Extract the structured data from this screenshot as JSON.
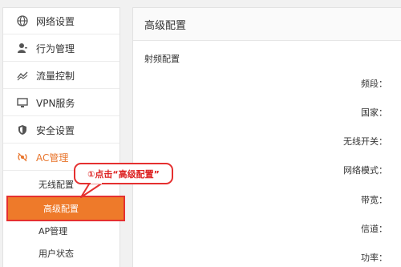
{
  "sidebar": {
    "items": [
      {
        "label": "网络设置",
        "icon": "globe-icon"
      },
      {
        "label": "行为管理",
        "icon": "user-icon"
      },
      {
        "label": "流量控制",
        "icon": "traffic-icon"
      },
      {
        "label": "VPN服务",
        "icon": "monitor-icon"
      },
      {
        "label": "安全设置",
        "icon": "shield-icon"
      },
      {
        "label": "AC管理",
        "icon": "wireless-icon"
      }
    ],
    "subitems": [
      {
        "label": "无线配置"
      },
      {
        "label": "高级配置"
      },
      {
        "label": "AP管理"
      },
      {
        "label": "用户状态"
      }
    ]
  },
  "main": {
    "title": "高级配置",
    "section": "射频配置",
    "fields": [
      "频段：",
      "国家：",
      "无线开关：",
      "网络模式：",
      "带宽：",
      "信道：",
      "功率："
    ]
  },
  "callout": {
    "text": "①点击“高级配置”"
  },
  "colors": {
    "accent": "#ee7a2a",
    "highlight": "#e53030"
  }
}
